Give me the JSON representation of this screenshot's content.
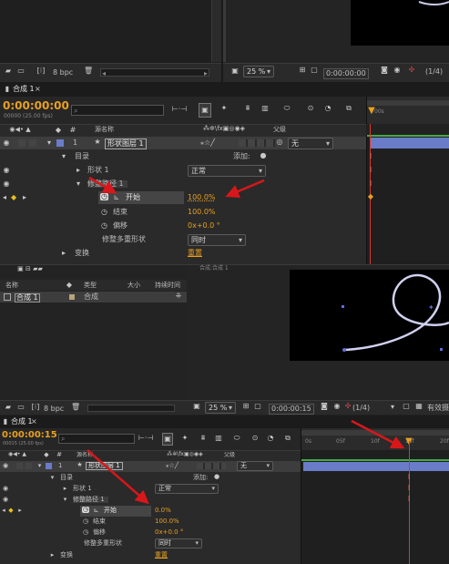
{
  "top_project_panel": {
    "bpc": "8 bpc"
  },
  "top_viewer": {
    "zoom": "25 %",
    "timecode": "0:00:00:00",
    "quality": "(1/4)"
  },
  "timeline1": {
    "tab": "合成 1",
    "timecode": "0:00:00:00",
    "fps": "00000 (25.00 fps)",
    "search_placeholder": "",
    "ruler": "00s",
    "col_source": "源名称",
    "col_parent": "父级",
    "layer_num": "1",
    "layer_name": "形状图层 1",
    "parent_value": "无",
    "contents": "目录",
    "add_label": "添加:",
    "shape1": "形状 1",
    "blend_mode": "正常",
    "trim": "修整路径 1",
    "start_label": "开始",
    "start_value": "100.0%",
    "end_label": "结束",
    "end_value": "100.0%",
    "offset_label": "偏移",
    "offset_value": "0x+0.0 °",
    "multi_label": "修整多重形状",
    "multi_value": "同时",
    "transform": "变换",
    "reset": "重置"
  },
  "project2": {
    "col_name": "名称",
    "col_type": "类型",
    "col_size": "大小",
    "col_duration": "持续时间",
    "item_name": "合成 1",
    "item_type": "合成",
    "bpc": "8 bpc",
    "viewer_caption": "合成:合成 1"
  },
  "viewer2": {
    "zoom": "25 %",
    "timecode": "0:00:00:15",
    "quality": "(1/4)",
    "active_camera": "有效摄"
  },
  "timeline2": {
    "tab": "合成 1",
    "timecode": "0:00:00:15",
    "fps": "00015 (25.00 fps)",
    "ticks": [
      "0s",
      "05f",
      "10f",
      "15f",
      "20f"
    ],
    "col_source": "源名称",
    "col_parent": "父级",
    "layer_num": "1",
    "layer_name": "形状图层 1",
    "parent_value": "无",
    "contents": "目录",
    "add_label": "添加:",
    "shape1": "形状 1",
    "blend_mode": "正常",
    "trim": "修整路径 1",
    "start_label": "开始",
    "start_value": "0.0%",
    "end_label": "结束",
    "end_value": "100.0%",
    "offset_label": "偏移",
    "offset_value": "0x+0.0 °",
    "multi_label": "修整多重形状",
    "multi_value": "同时",
    "transform": "变换",
    "reset": "重置"
  },
  "colors": {
    "accent": "#e8a020",
    "keyframe": "#b22222",
    "annotation": "#d8171b",
    "layer_bar": "#6a7cc8"
  }
}
